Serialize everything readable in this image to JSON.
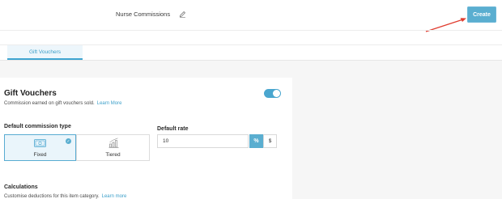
{
  "header": {
    "title": "Nurse Commissions",
    "create_label": "Create"
  },
  "tabs": [
    {
      "label": "Gift Vouchers",
      "active": true
    }
  ],
  "section": {
    "title": "Gift Vouchers",
    "description": "Commission earned on gift vouchers sold.",
    "learn_more": "Learn More",
    "enabled": true
  },
  "commission_type": {
    "label": "Default commission type",
    "options": [
      {
        "label": "Fixed",
        "selected": true
      },
      {
        "label": "Tiered",
        "selected": false
      }
    ]
  },
  "default_rate": {
    "label": "Default rate",
    "value": "10",
    "units": [
      "%",
      "$"
    ],
    "selected_unit": "%"
  },
  "calculations": {
    "title": "Calculations",
    "description": "Customise deductions for this item category.",
    "learn_more": "Learn more"
  },
  "colors": {
    "accent": "#5aaed0",
    "annotation_arrow": "#e03c2f"
  }
}
